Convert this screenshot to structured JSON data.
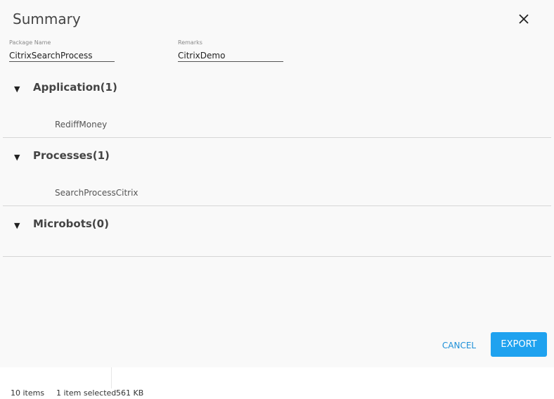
{
  "dialog": {
    "title": "Summary",
    "close_icon": "close-icon"
  },
  "fields": {
    "package_name": {
      "label": "Package Name",
      "value": "CitrixSearchProcess"
    },
    "remarks": {
      "label": "Remarks",
      "value": "CitrixDemo"
    }
  },
  "sections": [
    {
      "label": "Application(1)",
      "expanded": true,
      "items": [
        "RediffMoney"
      ]
    },
    {
      "label": "Processes(1)",
      "expanded": true,
      "items": [
        "SearchProcessCitrix"
      ]
    },
    {
      "label": "Microbots(0)",
      "expanded": true,
      "items": []
    }
  ],
  "actions": {
    "cancel_label": "CANCEL",
    "export_label": "EXPORT"
  },
  "colors": {
    "accent": "#1fa2ef",
    "link": "#1e90d8"
  },
  "statusbar": {
    "items_count": "10 items",
    "selection": "1 item selected",
    "size": "561 KB"
  }
}
